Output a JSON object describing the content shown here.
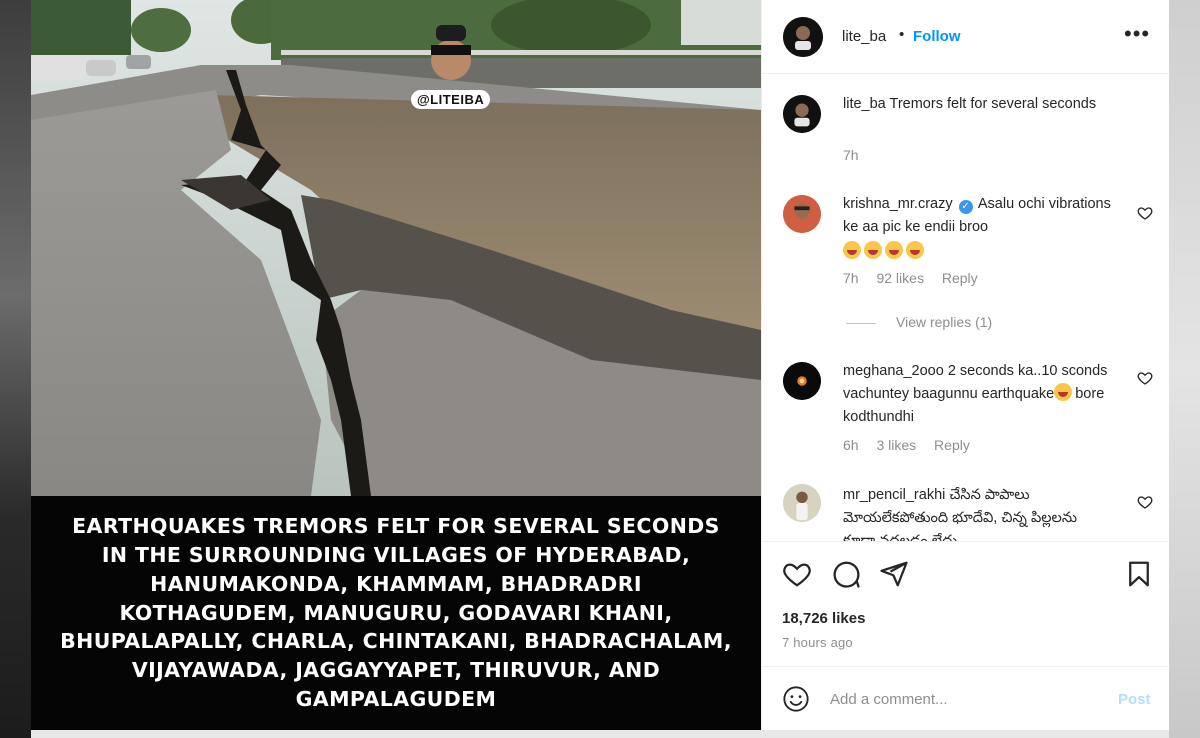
{
  "post": {
    "username": "lite_ba",
    "follow_label": "Follow",
    "separator": "•",
    "more_label": "•••",
    "watermark": "@LITEIBA",
    "caption_image_text": "Earthquakes tremors felt for several seconds\nin the surrounding villages of Hyderabad,\nHanumakonda, Khammam, Bhadradri\nKothagudem, Manuguru, Godavari Khani,\nBhupalapally, Charla, Chintakani, Bhadrachalam,\nVijayawada, Jaggayyapet, Thiruvur, and\nGampalagudem"
  },
  "caption": {
    "username": "lite_ba",
    "text": "Tremors felt for several seconds",
    "time": "7h"
  },
  "comments": [
    {
      "username": "krishna_mr.crazy",
      "verified": true,
      "text": "Asalu ochi vibrations ke aa pic ke endii broo",
      "time": "7h",
      "likes": "92 likes",
      "reply_label": "Reply",
      "view_replies": "View replies (1)"
    },
    {
      "username": "meghana_2ooo",
      "text_part1": "2 seconds ka..10 sconds vachuntey baagunnu earthquake",
      "text_part2": "bore kodthundhi",
      "time": "6h",
      "likes": "3 likes",
      "reply_label": "Reply"
    },
    {
      "username": "mr_pencil_rakhi",
      "text": "చేసిన పాపాలు మోయలేకపోతుంది భూదేవి, చిన్న పిల్లలను కూడా వదలడం లేదు"
    }
  ],
  "engagement": {
    "likes": "18,726 likes",
    "time_ago": "7 hours ago"
  },
  "composer": {
    "placeholder": "Add a comment...",
    "post_label": "Post"
  },
  "colors": {
    "link_blue": "#0095f6",
    "post_disabled": "#b2dffc",
    "muted": "#8e8e8e"
  },
  "icons": [
    "more-icon",
    "verified-icon",
    "heart-icon",
    "comment-icon",
    "share-icon",
    "bookmark-icon",
    "smiley-icon"
  ]
}
